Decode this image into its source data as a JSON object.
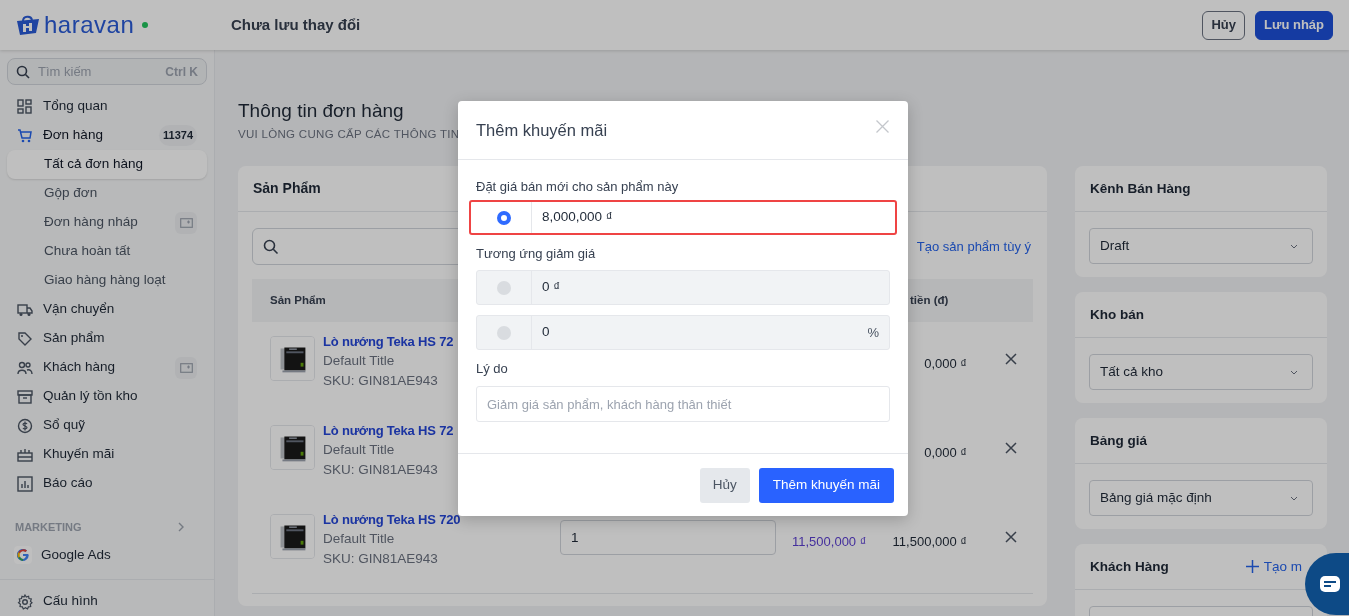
{
  "header": {
    "logo": "haravan",
    "title": "Chưa lưu thay đổi",
    "buttons": [
      {
        "label": "Hủy",
        "kind": "outline"
      },
      {
        "label": "Lưu nháp",
        "kind": "primary"
      }
    ]
  },
  "sidebar": {
    "search": {
      "placeholder": "Tìm kiếm",
      "shortcut": "Ctrl K"
    },
    "items": [
      {
        "label": "Tổng quan",
        "selected": false
      },
      {
        "label": "Đơn hàng",
        "selected": true,
        "badge": "11374",
        "children": [
          {
            "label": "Tất cả đơn hàng",
            "selected": true
          },
          {
            "label": "Gộp đơn",
            "selected": false
          },
          {
            "label": "Đơn hàng nháp",
            "selected": false,
            "has_action": true
          },
          {
            "label": "Chưa hoàn tất",
            "selected": false
          },
          {
            "label": "Giao hàng hàng loạt",
            "selected": false
          }
        ]
      },
      {
        "label": "Vận chuyển",
        "selected": false
      },
      {
        "label": "Sản phẩm",
        "selected": false
      },
      {
        "label": "Khách hàng",
        "selected": false,
        "has_action": true
      },
      {
        "label": "Quản lý tồn kho",
        "selected": false
      },
      {
        "label": "Sổ quỹ",
        "selected": false
      },
      {
        "label": "Khuyến mãi",
        "selected": false
      },
      {
        "label": "Báo cáo",
        "selected": false
      }
    ],
    "marketing": {
      "label": "MARKETING",
      "items": [
        {
          "label": "Google Ads"
        }
      ]
    },
    "footer_item": {
      "label": "Cấu hình"
    }
  },
  "main": {
    "title": "Thông tin đơn hàng",
    "subtitle": "VUI LÒNG CUNG CẤP CÁC THÔNG TIN",
    "products": {
      "title": "Sản Phẩm",
      "link": "Tạo sản phẩm tùy ý",
      "columns": [
        "Sản Phẩm",
        "tiền (đ)"
      ],
      "rows": [
        {
          "name": "Lò nướng Teka HS 72",
          "variant": "Default Title",
          "sku": "SKU: GIN81AE943",
          "total": "0,000 ₫"
        },
        {
          "name": "Lò nướng Teka HS 72",
          "variant": "Default Title",
          "sku": "SKU: GIN81AE943",
          "total": "0,000 ₫"
        },
        {
          "name": "Lò nướng Teka HS 720",
          "variant": "Default Title",
          "sku": "SKU: GIN81AE943",
          "quantity": "1",
          "price": "11,500,000 ₫",
          "total": "11,500,000 ₫"
        }
      ]
    },
    "side_cards": [
      {
        "title": "Kênh Bán Hàng",
        "select": "Draft"
      },
      {
        "title": "Kho bán",
        "select": "Tất cả kho"
      },
      {
        "title": "Bảng giá",
        "select": "Bảng giá mặc định"
      },
      {
        "title": "Khách Hàng",
        "action": "Tạo m"
      }
    ]
  },
  "modal": {
    "title": "Thêm khuyến mãi",
    "price_label": "Đặt giá bán mới cho sản phẩm này",
    "discount_label": "Tương ứng giảm giá",
    "options": [
      {
        "value": "8,000,000 ₫",
        "selected": true,
        "disabled": false,
        "highlighted": true
      },
      {
        "value": "0 ₫",
        "selected": false,
        "disabled": true,
        "highlighted": false
      },
      {
        "value": "0",
        "suffix": "%",
        "selected": false,
        "disabled": true,
        "highlighted": false
      }
    ],
    "reason_label": "Lý do",
    "reason_placeholder": "Giảm giá sản phẩm, khách hàng thân thiết",
    "buttons": [
      {
        "label": "Hủy",
        "kind": "secondary"
      },
      {
        "label": "Thêm khuyến mãi",
        "kind": "primary"
      }
    ]
  }
}
